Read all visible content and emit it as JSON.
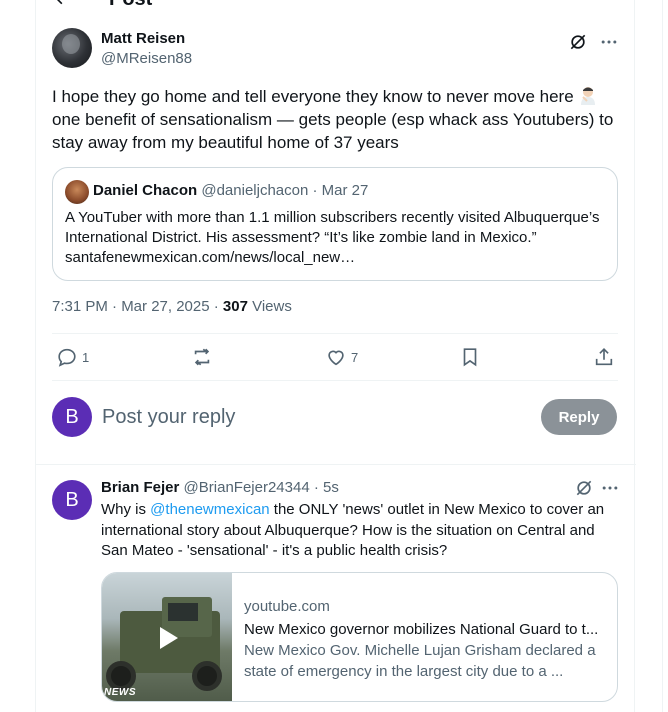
{
  "header": {
    "title": "Post"
  },
  "post": {
    "author_name": "Matt Reisen",
    "author_handle": "@MReisen88",
    "text_line1": "I hope they go home and tell everyone they know to never move here",
    "text_rest": "one benefit of sensationalism — gets people (esp whack ass Youtubers) to stay away from my beautiful home of 37 years",
    "timestamp": "7:31 PM · Mar 27, 2025 · ",
    "views_count": "307",
    "views_label": " Views",
    "stats": {
      "replies": "1",
      "likes": "7"
    }
  },
  "quote": {
    "name": "Daniel Chacon",
    "meta": " @danieljchacon · Mar 27",
    "text": "A YouTuber with more than 1.1 million subscribers recently visited Albuquerque’s International District. His assessment? “It’s like zombie land in Mexico.” santafenewmexican.com/news/local_new…"
  },
  "composer": {
    "avatar_letter": "B",
    "placeholder": "Post your reply",
    "reply_label": "Reply"
  },
  "reply_post": {
    "avatar_letter": "B",
    "name": "Brian Fejer",
    "meta": " @BrianFejer24344 · 5s",
    "text_before": "Why is ",
    "mention": "@thenewmexican",
    "text_after": " the ONLY 'news' outlet in New Mexico to cover an international story about Albuquerque? How is the situation on Central and San Mateo - 'sensational' - it's a public health crisis?",
    "link": {
      "domain": "youtube.com",
      "title": "New Mexico governor mobilizes National Guard to t...",
      "description": "New Mexico Gov. Michelle Lujan Grisham declared a state of emergency in the largest city due to a ...",
      "thumb_label": "NEWS"
    }
  },
  "colors": {
    "accent": "#1d9bf0",
    "avatar_purple": "#5b2db5",
    "secondary_text": "#536471"
  },
  "icons": [
    "back-arrow-icon",
    "grok-icon",
    "more-icon",
    "reply-icon",
    "repost-icon",
    "like-icon",
    "bookmark-icon",
    "share-icon",
    "play-icon"
  ]
}
